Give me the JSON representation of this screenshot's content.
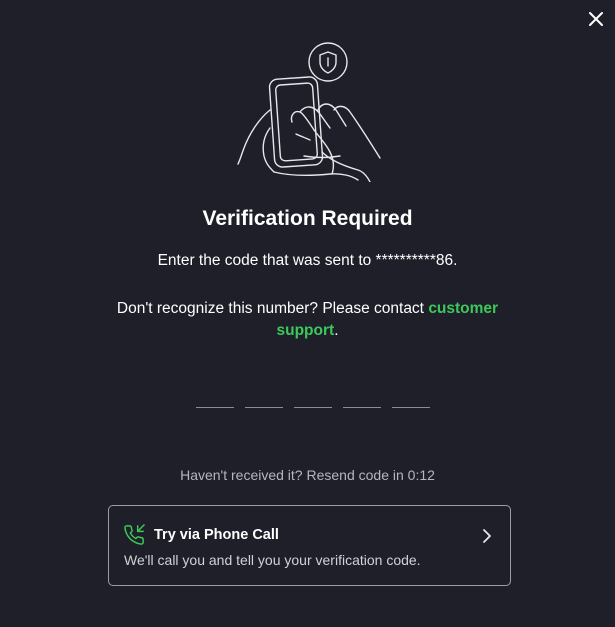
{
  "dialog": {
    "title": "Verification Required",
    "subtitle": "Enter the code that was sent to **********86.",
    "support_prefix": "Don't recognize this number? Please contact ",
    "support_link": "customer support",
    "support_suffix": ".",
    "close_icon": "close-icon",
    "illustration_icon": "phone-shield-illustration"
  },
  "code": {
    "length": 5,
    "values": [
      "",
      "",
      "",
      "",
      ""
    ]
  },
  "resend": {
    "text": "Haven't received it? Resend code in 0:12"
  },
  "phone_call": {
    "title": "Try via Phone Call",
    "description": "We'll call you and tell you your verification code.",
    "icon": "phone-incoming-icon",
    "chevron": "chevron-right-icon"
  },
  "colors": {
    "background": "#1e1f29",
    "accent": "#3cc85a",
    "text": "#ffffff",
    "muted": "#b5b7bf",
    "border": "#9a9ca6"
  }
}
